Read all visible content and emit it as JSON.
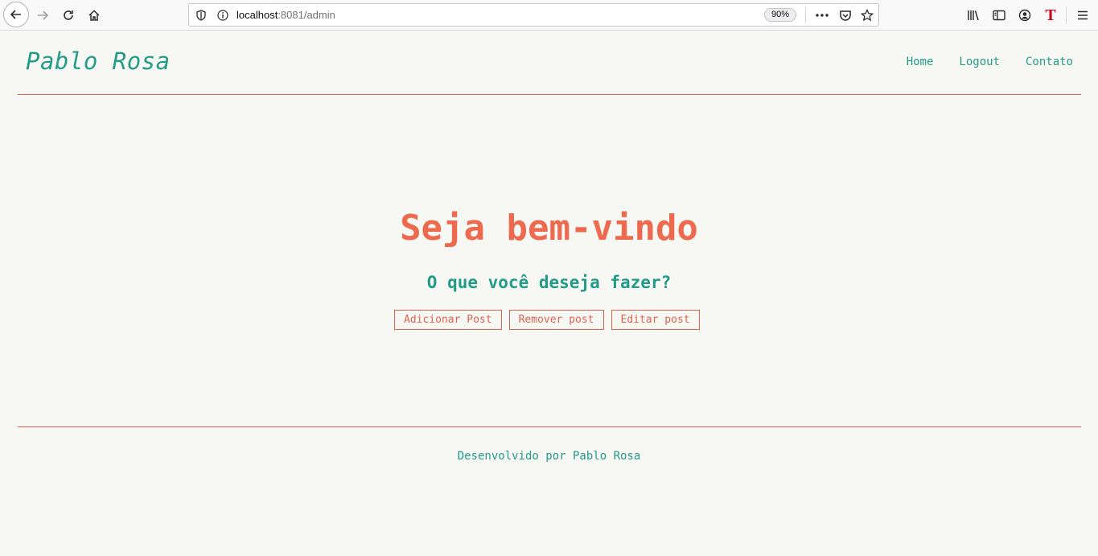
{
  "browser": {
    "url_host": "localhost",
    "url_rest": ":8081/admin",
    "zoom": "90%",
    "icons": [
      "back-arrow-icon",
      "forward-arrow-icon",
      "reload-icon",
      "home-icon",
      "tracking-shield-icon",
      "info-icon",
      "more-icon",
      "pocket-icon",
      "bookmark-star-icon",
      "library-icon",
      "sidebar-icon",
      "account-icon",
      "extension-t-icon",
      "hamburger-menu-icon"
    ],
    "extension_glyph": "T"
  },
  "header": {
    "brand": "Pablo Rosa",
    "nav": [
      "Home",
      "Logout",
      "Contato"
    ]
  },
  "main": {
    "title": "Seja bem-vindo",
    "subtitle": "O que você deseja fazer?",
    "actions": [
      "Adicionar Post",
      "Remover post",
      "Editar post"
    ]
  },
  "footer": {
    "text": "Desenvolvido por Pablo Rosa"
  },
  "colors": {
    "teal": "#239b89",
    "coral": "#ee6a4f",
    "background": "#f7f7f3"
  }
}
